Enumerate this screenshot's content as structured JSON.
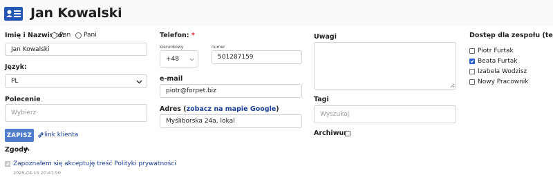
{
  "header": {
    "title": "Jan Kowalski",
    "icon": "id-card-icon",
    "accent": "#2356b5"
  },
  "name_section": {
    "label": "Imię i Nazwisko:",
    "salutation_options": [
      "Pan",
      "Pani"
    ],
    "name_value": "Jan Kowalski"
  },
  "language": {
    "label": "Język:",
    "value": "PL"
  },
  "command": {
    "label": "Polecenie",
    "placeholder": "Wybierz"
  },
  "actions": {
    "save_label": "ZAPISZ",
    "client_link_label": "link klienta"
  },
  "consents": {
    "label": "Zgody",
    "items": [
      {
        "label": "Zapoznałem się akceptuję treść Polityki prywatności",
        "timestamp": "2025-04-15 20:47:50",
        "checked": true
      }
    ]
  },
  "phone": {
    "label": "Telefon:",
    "required_mark": "*",
    "prefix_label": "kierunkowy",
    "prefix_value": "+48",
    "number_label": "numer",
    "number_value": "501287159"
  },
  "email": {
    "label": "e-mail",
    "value": "piotr@forpet.biz"
  },
  "address": {
    "label": "Adres",
    "paren_open": "(",
    "map_link": "zobacz na mapie Google",
    "paren_close": ")",
    "value": "Myśliborska 24a, lokal"
  },
  "notes": {
    "label": "Uwagi",
    "value": ""
  },
  "tags": {
    "label": "Tagi",
    "placeholder": "Wyszukaj"
  },
  "archive": {
    "label": "Archiwum",
    "checked": false
  },
  "team_access": {
    "label": "Dostęp dla zespołu (test)",
    "members": [
      {
        "name": "Piotr Furtak",
        "checked": false
      },
      {
        "name": "Beata Furtak",
        "checked": true
      },
      {
        "name": "Izabela Wodzisz",
        "checked": false
      },
      {
        "name": "Nowy Pracownik",
        "checked": false
      }
    ]
  },
  "colors": {
    "primary_button": "#4f7ccc",
    "link": "#1a3f94",
    "required": "#d9262c",
    "checkbox_checked": "#2a5fd1"
  }
}
